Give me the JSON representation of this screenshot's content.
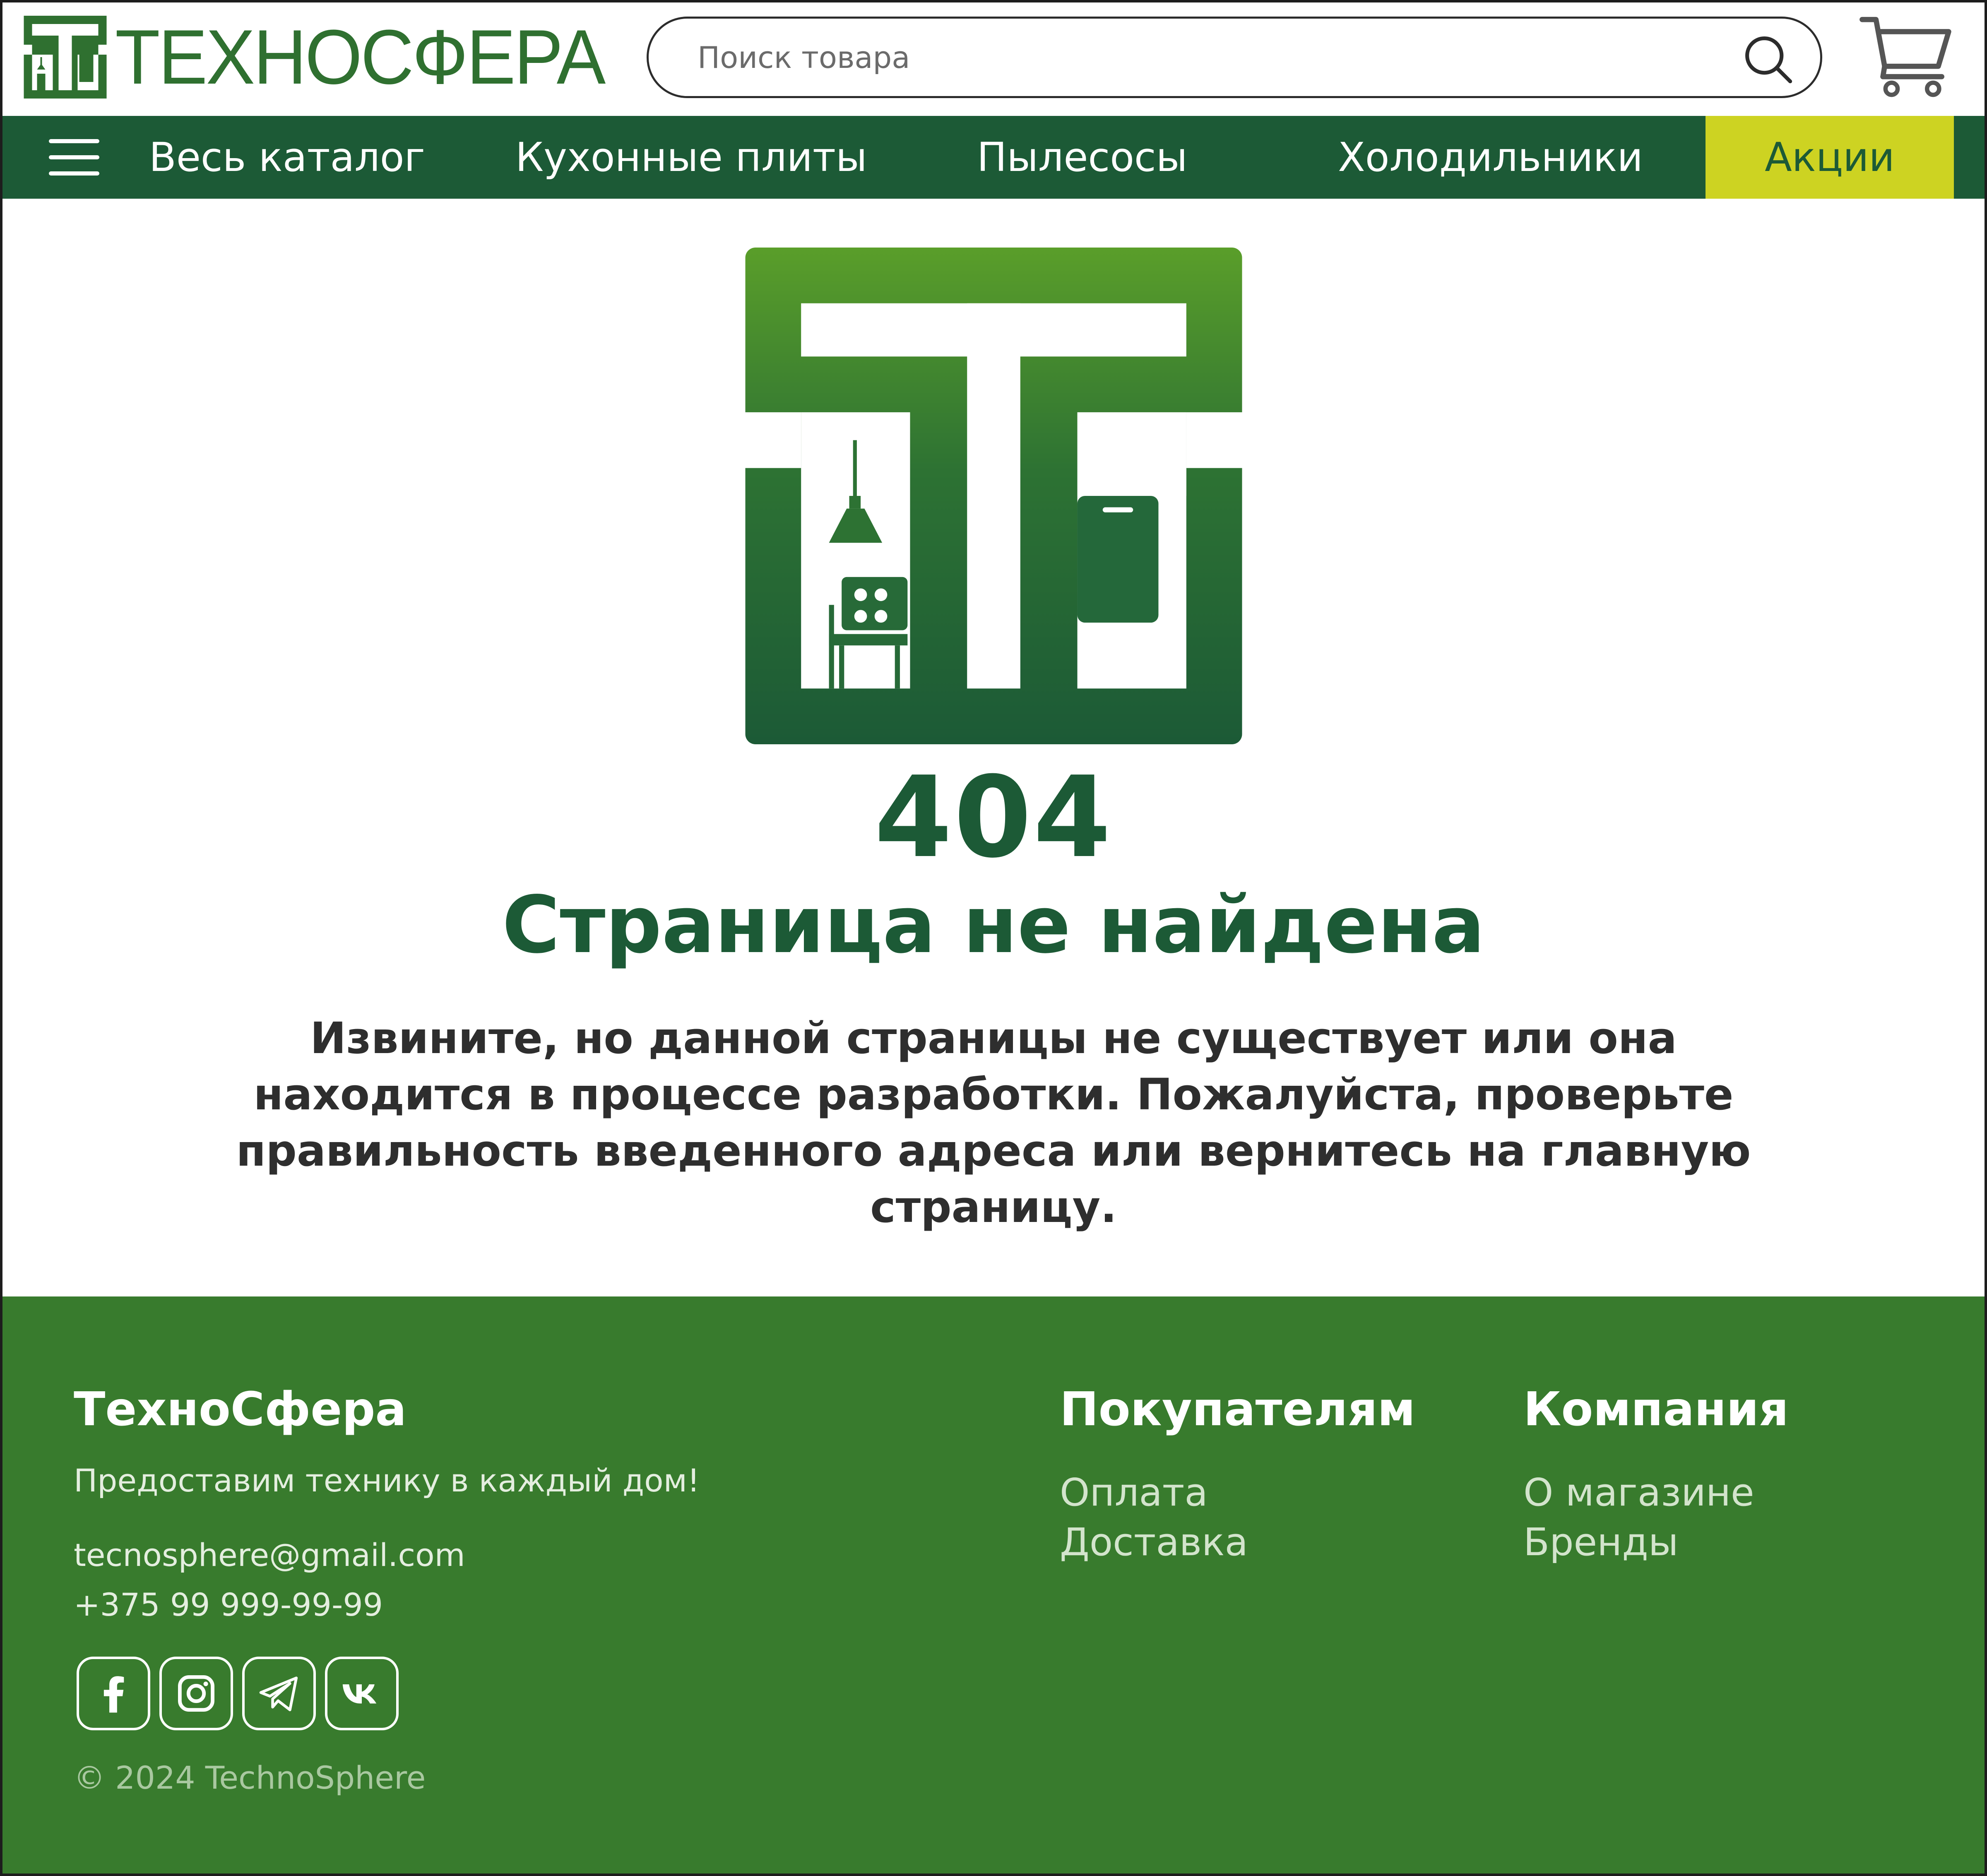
{
  "header": {
    "brand": "ТЕХНОСФЕРА",
    "search": {
      "placeholder": "Поиск товара"
    }
  },
  "nav": {
    "items": [
      {
        "label": "Весь каталог"
      },
      {
        "label": "Кухонные плиты"
      },
      {
        "label": "Пылесосы"
      },
      {
        "label": "Холодильники"
      },
      {
        "label": "Акции"
      }
    ]
  },
  "error": {
    "code": "404",
    "title": "Страница не найдена",
    "message": "Извините, но данной страницы не существует или она находится в процессе разработки. Пожалуйста, проверьте правильность введенного адреса или вернитесь на главную страницу."
  },
  "footer": {
    "brand": "ТехноСфера",
    "tagline": "Предоставим технику в каждый дом!",
    "email": "tecnosphere@gmail.com",
    "phone": "+375 99 999-99-99",
    "socials": [
      "facebook-icon",
      "instagram-icon",
      "telegram-icon",
      "vk-icon"
    ],
    "copyright": "© 2024 TechnoSphere",
    "columns": [
      {
        "title": "Покупателям",
        "links": [
          "Оплата",
          "Доставка"
        ]
      },
      {
        "title": "Компания",
        "links": [
          "О магазине",
          "Бренды"
        ]
      }
    ]
  },
  "colors": {
    "primary": "#1c5a36",
    "footer": "#387b2d",
    "promo": "#cdd322",
    "logo_gradient_top": "#5a9e2a",
    "logo_gradient_bottom": "#1c5a36"
  }
}
